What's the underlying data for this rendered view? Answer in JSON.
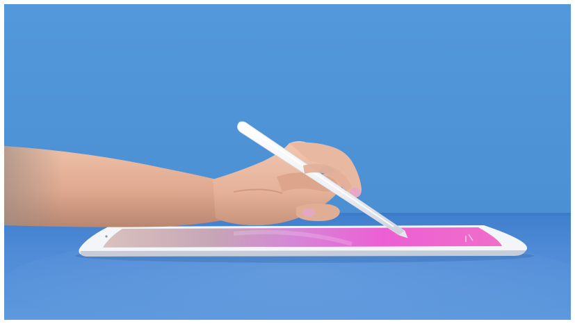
{
  "image": {
    "kind": "photo",
    "subjects": [
      "hand-holding-stylus",
      "tablet"
    ]
  },
  "colors": {
    "wall": "#4f96d8",
    "wall_dark": "#3f86cc",
    "table": "#4a86d2",
    "table_light": "#6aa2e0",
    "tablet_body": "#f1f4f8",
    "screen_pink": "#e860d6",
    "screen_violet": "#b97ee6",
    "skin": "#e6b6a0",
    "skin_shadow": "#c9876e",
    "nail": "#e6a4c8",
    "stylus": "#f6f7f9"
  }
}
